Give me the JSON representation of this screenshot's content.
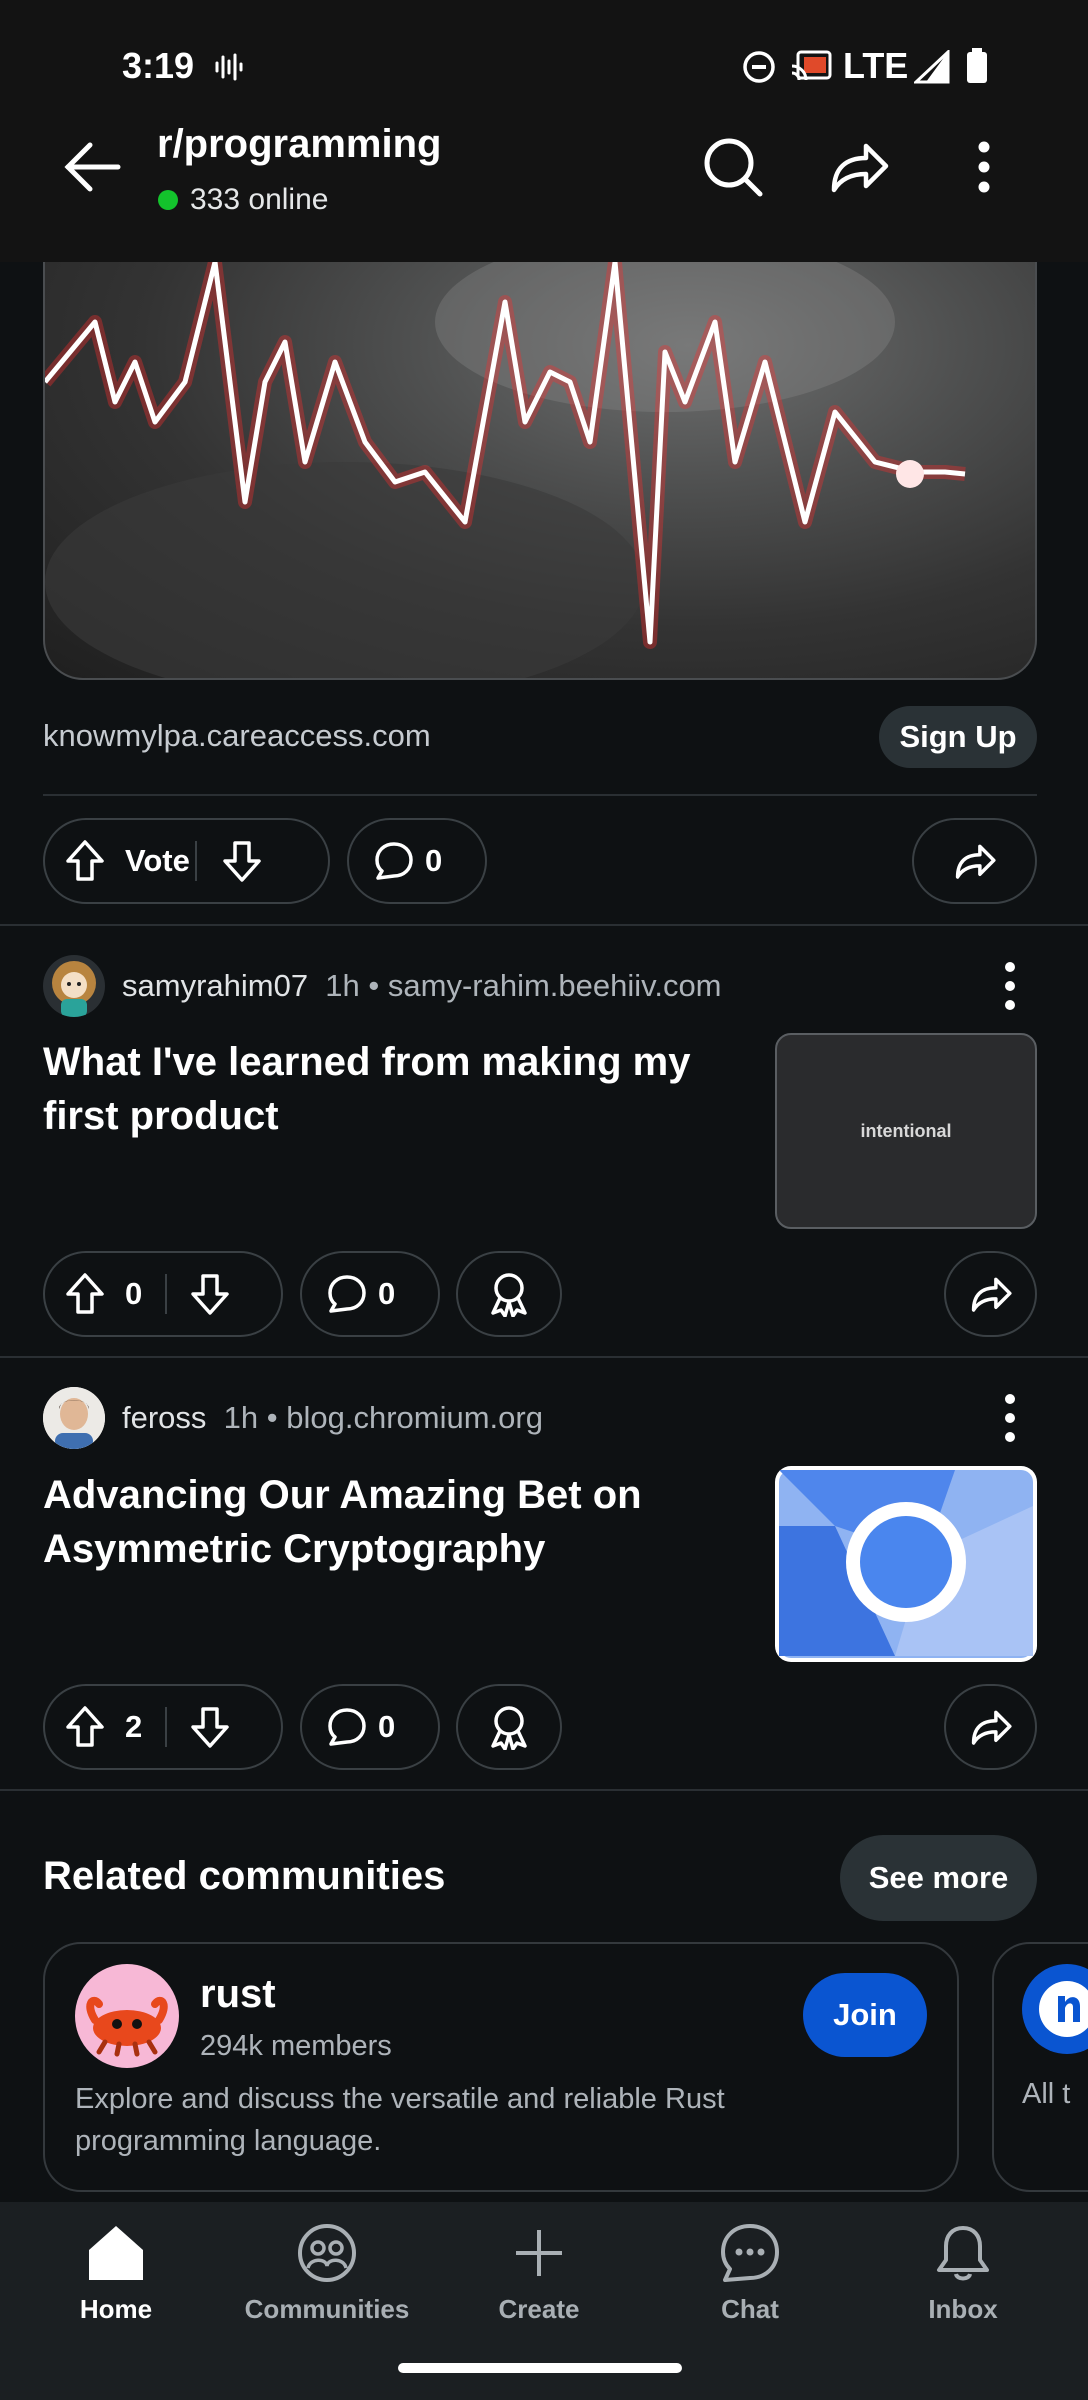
{
  "status_bar": {
    "time": "3:19",
    "network": "LTE"
  },
  "header": {
    "title": "r/programming",
    "online": "333 online"
  },
  "ad": {
    "domain": "knowmylpa.careaccess.com",
    "cta": "Sign Up",
    "vote_label": "Vote",
    "comments": "0"
  },
  "posts": [
    {
      "user": "samyrahim07",
      "age": "1h",
      "domain": "samy-rahim.beehiiv.com",
      "title": "What I've learned from making my first product",
      "thumb_text": "intentional",
      "votes": "0",
      "comments": "0"
    },
    {
      "user": "feross",
      "age": "1h",
      "domain": "blog.chromium.org",
      "title": "Advancing Our Amazing Bet on Asymmetric Cryptography",
      "votes": "2",
      "comments": "0"
    }
  ],
  "related": {
    "title": "Related communities",
    "see_more": "See more",
    "card": {
      "name": "rust",
      "members": "294k members",
      "description": "Explore and discuss the versatile and reliable Rust programming language.",
      "join": "Join"
    },
    "next_card_text": "All t"
  },
  "nav": {
    "home": "Home",
    "communities": "Communities",
    "create": "Create",
    "chat": "Chat",
    "inbox": "Inbox"
  },
  "colors": {
    "background": "#0e1113",
    "join": "#0a55d1",
    "online": "#13c32c"
  }
}
